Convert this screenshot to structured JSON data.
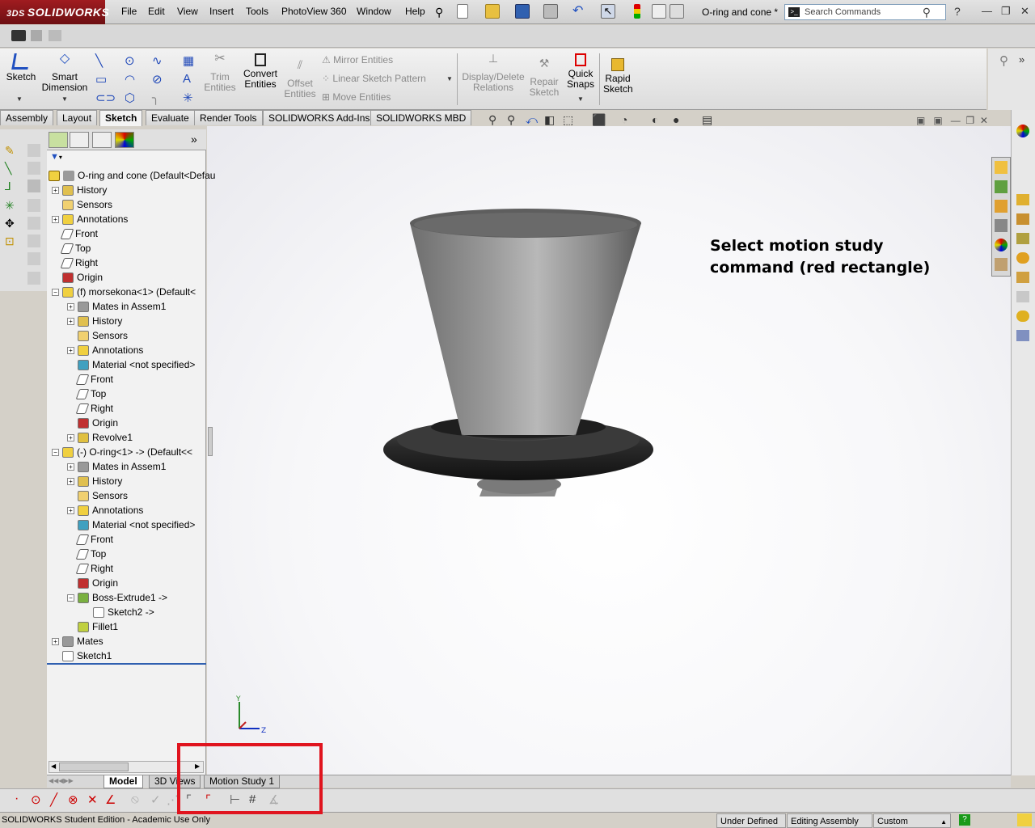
{
  "app": {
    "logo": "SOLIDWORKS",
    "logo_prefix": "3DS"
  },
  "menu": [
    "File",
    "Edit",
    "View",
    "Insert",
    "Tools",
    "PhotoView 360",
    "Window",
    "Help"
  ],
  "document_title": "O-ring and cone *",
  "search": {
    "placeholder": "Search Commands"
  },
  "command_manager": {
    "sketch": "Sketch",
    "smart_dimension": [
      "Smart",
      "Dimension"
    ],
    "trim_entities": [
      "Trim",
      "Entities"
    ],
    "convert_entities": [
      "Convert",
      "Entities"
    ],
    "offset_entities": [
      "Offset",
      "Entities"
    ],
    "mirror_entities": "Mirror Entities",
    "linear_sketch_pattern": "Linear Sketch Pattern",
    "move_entities": "Move Entities",
    "display_delete_relations": [
      "Display/Delete",
      "Relations"
    ],
    "repair_sketch": [
      "Repair",
      "Sketch"
    ],
    "quick_snaps": [
      "Quick",
      "Snaps"
    ],
    "rapid_sketch": [
      "Rapid",
      "Sketch"
    ]
  },
  "tabs": [
    "Assembly",
    "Layout",
    "Sketch",
    "Evaluate",
    "Render Tools",
    "SOLIDWORKS Add-Ins",
    "SOLIDWORKS MBD"
  ],
  "active_tab": "Sketch",
  "tree": {
    "root": "O-ring and cone  (Default<Defau",
    "nodes": [
      {
        "label": "History",
        "indent": 0,
        "exp": true,
        "icon": "history-icon"
      },
      {
        "label": "Sensors",
        "indent": 0,
        "exp": false,
        "icon": "sensor-icon"
      },
      {
        "label": "Annotations",
        "indent": 0,
        "exp": true,
        "icon": "annotation-icon"
      },
      {
        "label": "Front",
        "indent": 0,
        "exp": false,
        "icon": "plane-icon"
      },
      {
        "label": "Top",
        "indent": 0,
        "exp": false,
        "icon": "plane-icon"
      },
      {
        "label": "Right",
        "indent": 0,
        "exp": false,
        "icon": "plane-icon"
      },
      {
        "label": "Origin",
        "indent": 0,
        "exp": false,
        "icon": "origin-icon"
      },
      {
        "label": "(f) morsekona<1> (Default<",
        "indent": 0,
        "exp": true,
        "open": true,
        "icon": "part-icon"
      },
      {
        "label": "Mates in Assem1",
        "indent": 1,
        "exp": true,
        "icon": "mates-icon"
      },
      {
        "label": "History",
        "indent": 1,
        "exp": true,
        "icon": "history-icon"
      },
      {
        "label": "Sensors",
        "indent": 1,
        "exp": false,
        "icon": "sensor-icon"
      },
      {
        "label": "Annotations",
        "indent": 1,
        "exp": true,
        "icon": "annotation-icon"
      },
      {
        "label": "Material <not specified>",
        "indent": 1,
        "exp": false,
        "icon": "material-icon"
      },
      {
        "label": "Front",
        "indent": 1,
        "exp": false,
        "icon": "plane-icon"
      },
      {
        "label": "Top",
        "indent": 1,
        "exp": false,
        "icon": "plane-icon"
      },
      {
        "label": "Right",
        "indent": 1,
        "exp": false,
        "icon": "plane-icon"
      },
      {
        "label": "Origin",
        "indent": 1,
        "exp": false,
        "icon": "origin-icon"
      },
      {
        "label": "Revolve1",
        "indent": 1,
        "exp": true,
        "icon": "revolve-icon"
      },
      {
        "label": "(-) O-ring<1> -> (Default<<",
        "indent": 0,
        "exp": true,
        "open": true,
        "icon": "part-icon"
      },
      {
        "label": "Mates in Assem1",
        "indent": 1,
        "exp": true,
        "icon": "mates-icon"
      },
      {
        "label": "History",
        "indent": 1,
        "exp": true,
        "icon": "history-icon"
      },
      {
        "label": "Sensors",
        "indent": 1,
        "exp": false,
        "icon": "sensor-icon"
      },
      {
        "label": "Annotations",
        "indent": 1,
        "exp": true,
        "icon": "annotation-icon"
      },
      {
        "label": "Material <not specified>",
        "indent": 1,
        "exp": false,
        "icon": "material-icon"
      },
      {
        "label": "Front",
        "indent": 1,
        "exp": false,
        "icon": "plane-icon"
      },
      {
        "label": "Top",
        "indent": 1,
        "exp": false,
        "icon": "plane-icon"
      },
      {
        "label": "Right",
        "indent": 1,
        "exp": false,
        "icon": "plane-icon"
      },
      {
        "label": "Origin",
        "indent": 1,
        "exp": false,
        "icon": "origin-icon"
      },
      {
        "label": "Boss-Extrude1 ->",
        "indent": 1,
        "exp": true,
        "open": true,
        "icon": "extrude-icon"
      },
      {
        "label": "Sketch2 ->",
        "indent": 2,
        "exp": false,
        "icon": "sketch-icon"
      },
      {
        "label": "Fillet1",
        "indent": 1,
        "exp": false,
        "icon": "fillet-icon"
      },
      {
        "label": "Mates",
        "indent": 0,
        "exp": true,
        "icon": "mates-icon"
      },
      {
        "label": "Sketch1",
        "indent": 0,
        "exp": false,
        "icon": "sketch-icon"
      }
    ]
  },
  "annotation": [
    "Select motion study",
    "command (red rectangle)"
  ],
  "bottom_tabs": [
    "Model",
    "3D Views",
    "Motion Study 1"
  ],
  "active_bottom_tab": "Model",
  "status": {
    "edition": "SOLIDWORKS Student Edition - Academic Use Only",
    "definition": "Under Defined",
    "mode": "Editing Assembly",
    "units": "Custom"
  },
  "colors": {
    "highlight_red": "#e0141e",
    "brand": "#8c1519"
  }
}
